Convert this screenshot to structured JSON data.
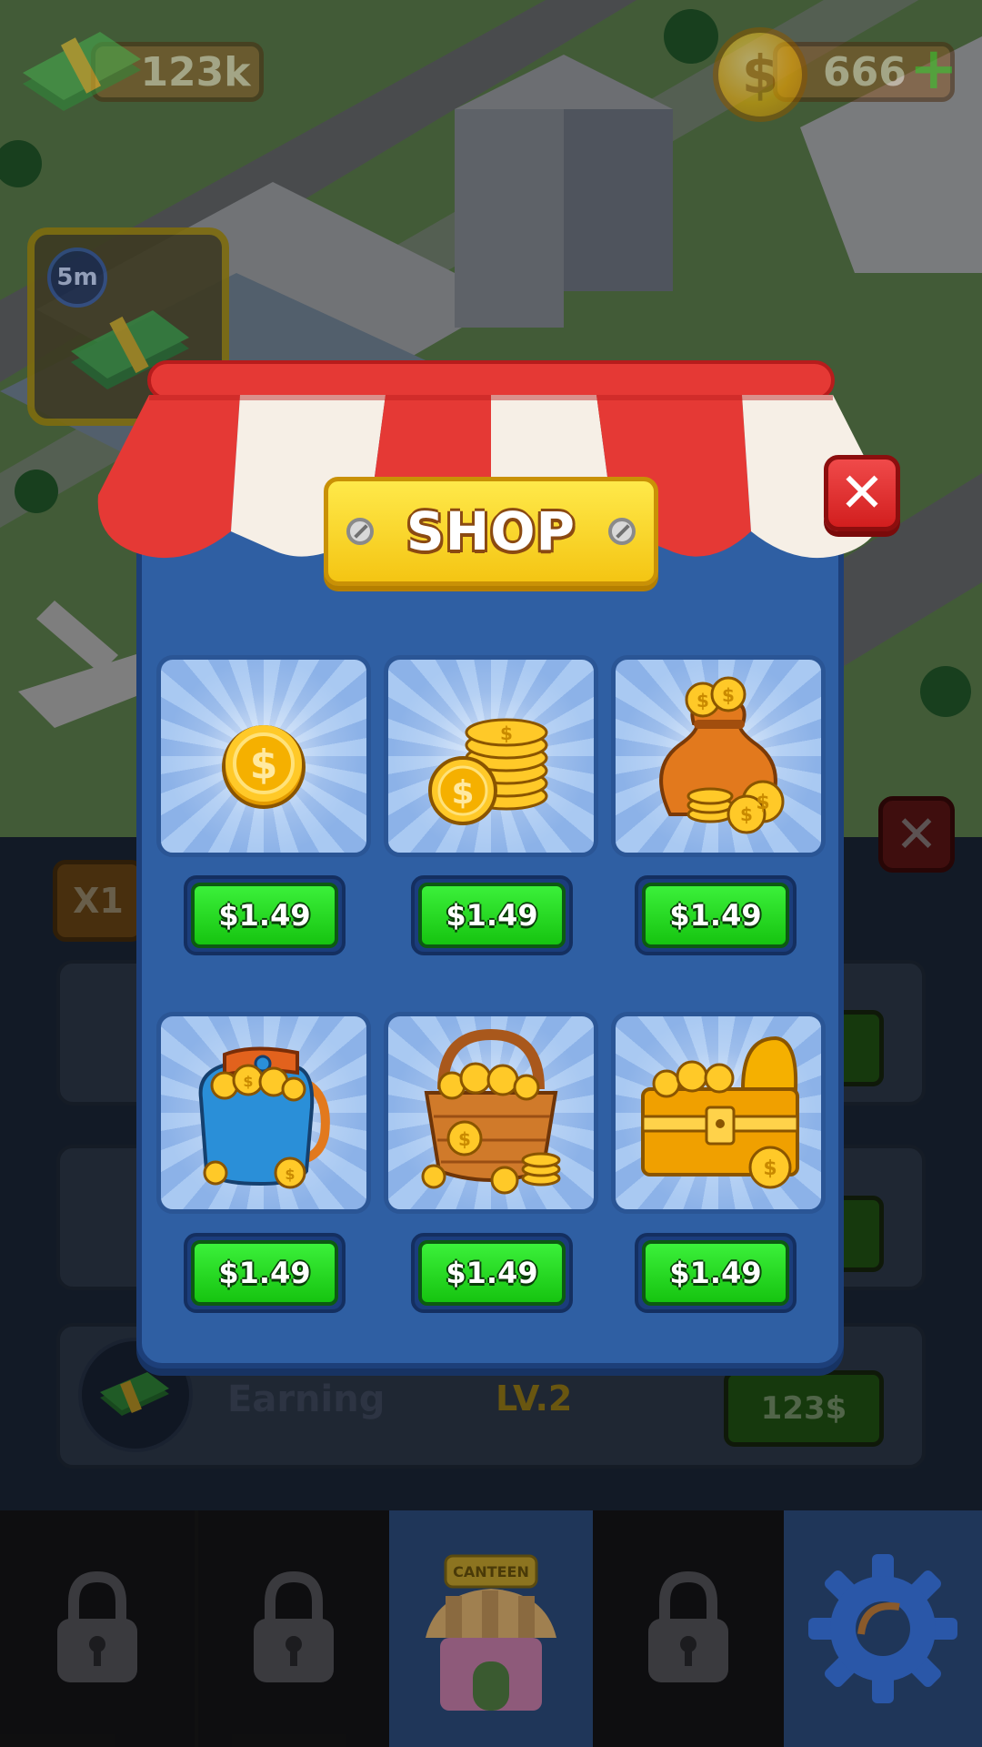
{
  "hud": {
    "cash_value": "123k",
    "coin_value": "666",
    "add_symbol": "+"
  },
  "boost": {
    "timer_label": "5m"
  },
  "under_panel": {
    "multiplier_label": "X1",
    "earning_row": {
      "label": "Earning",
      "level": "LV.2",
      "button_label": "123$"
    }
  },
  "shop": {
    "title": "SHOP",
    "close_symbol": "✕",
    "items": [
      {
        "icon": "single-coin",
        "price": "$1.49"
      },
      {
        "icon": "coin-stack",
        "price": "$1.49"
      },
      {
        "icon": "coin-sack",
        "price": "$1.49"
      },
      {
        "icon": "coin-backpack",
        "price": "$1.49"
      },
      {
        "icon": "coin-basket",
        "price": "$1.49"
      },
      {
        "icon": "treasure-chest",
        "price": "$1.49"
      }
    ]
  },
  "nav": {
    "canteen_label": "CANTEEN",
    "items": [
      "locked",
      "locked",
      "canteen",
      "locked",
      "settings"
    ]
  },
  "colors": {
    "modal_blue": "#2f5fa3",
    "price_green": "#16c410",
    "awning_red": "#e53935",
    "sign_yellow": "#f4c513",
    "close_red": "#d21e1e"
  }
}
